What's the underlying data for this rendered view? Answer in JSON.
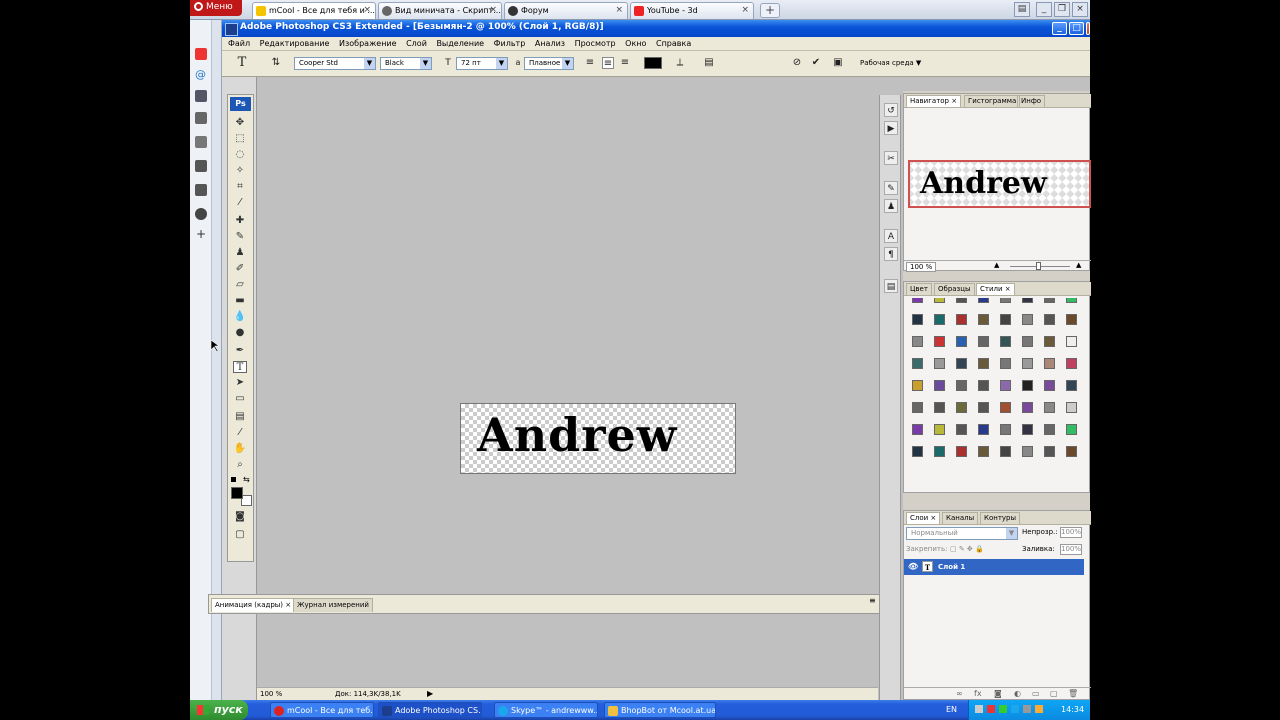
{
  "browser": {
    "menu_label": "Меню",
    "tabs": [
      {
        "title": "mCool - Все для тебя и ...",
        "active": true
      },
      {
        "title": "Вид миничата - Скрипт...",
        "active": false
      },
      {
        "title": "Форум",
        "active": false
      },
      {
        "title": "YouTube - 3d",
        "active": false
      }
    ],
    "new_tab": "+"
  },
  "photoshop": {
    "title": "Adobe Photoshop CS3 Extended - [Безымян-2 @ 100% (Слой 1, RGB/8)]",
    "menu": [
      "Файл",
      "Редактирование",
      "Изображение",
      "Слой",
      "Выделение",
      "Фильтр",
      "Анализ",
      "Просмотр",
      "Окно",
      "Справка"
    ],
    "options": {
      "font_family": "Cooper Std",
      "font_style": "Black",
      "font_size": "72 пт",
      "antialias": "Плавное",
      "workspace": "Рабочая среда ▼"
    },
    "toolbox_logo": "Ps",
    "canvas_text": "Andrew",
    "anim_panel": {
      "tab1": "Анимация (кадры)",
      "tab2": "Журнал измерений"
    },
    "status": {
      "zoom": "100 %",
      "doc": "Док: 114,3K/38,1K"
    },
    "navigator": {
      "tabs": [
        "Навигатор",
        "Гистограмма",
        "Инфо"
      ],
      "preview_text": "Andrew",
      "zoom": "100 %"
    },
    "styles_panel": {
      "tabs": [
        "Цвет",
        "Образцы",
        "Стили"
      ]
    },
    "layers": {
      "tabs": [
        "Слои",
        "Каналы",
        "Контуры"
      ],
      "blend_mode": "Нормальный",
      "opacity_label": "Непрозр.:",
      "opacity_value": "100%",
      "lock_label": "Закрепить:",
      "fill_label": "Заливка:",
      "fill_value": "100%",
      "layer_name": "Слой 1",
      "layer_thumb": "T"
    }
  },
  "taskbar": {
    "start": "пуск",
    "tasks": [
      {
        "title": "mCool - Все для теб...",
        "active": false
      },
      {
        "title": "Adobe Photoshop CS...",
        "active": true
      },
      {
        "title": "Skype™ - andrewww...",
        "active": false
      },
      {
        "title": "BhopBot от Mcool.at.ua",
        "active": false
      }
    ],
    "lang": "EN",
    "time": "14:34"
  }
}
